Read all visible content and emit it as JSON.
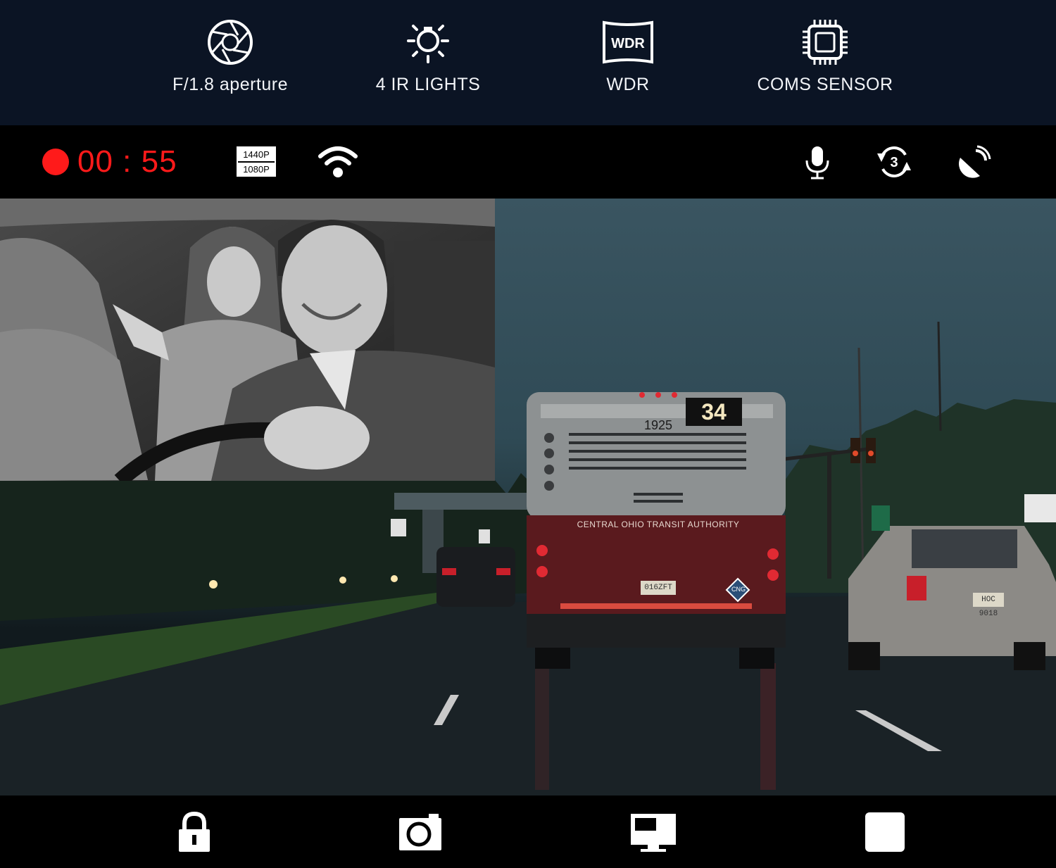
{
  "features": [
    {
      "icon": "aperture-icon",
      "label": "F/1.8 aperture"
    },
    {
      "icon": "ir-light-icon",
      "label": "4 IR LIGHTS"
    },
    {
      "icon": "wdr-icon",
      "label": "WDR",
      "icon_text": "WDR"
    },
    {
      "icon": "chip-icon",
      "label": "COMS SENSOR"
    }
  ],
  "status": {
    "recording_color": "#ff1a1a",
    "timer": "00 : 55",
    "resolution_top": "1440P",
    "resolution_bottom": "1080P",
    "loop_count": "3"
  },
  "scene": {
    "bus_route": "34",
    "bus_number": "1925",
    "bus_operator": "CENTRAL OHIO TRANSIT AUTHORITY",
    "bus_plate": "016ZFT",
    "bus_badge": "CNG",
    "suv_plate": "HOC 9018"
  },
  "controls": [
    {
      "icon": "lock-icon"
    },
    {
      "icon": "camera-icon"
    },
    {
      "icon": "screen-switch-icon"
    },
    {
      "icon": "stop-icon"
    }
  ]
}
